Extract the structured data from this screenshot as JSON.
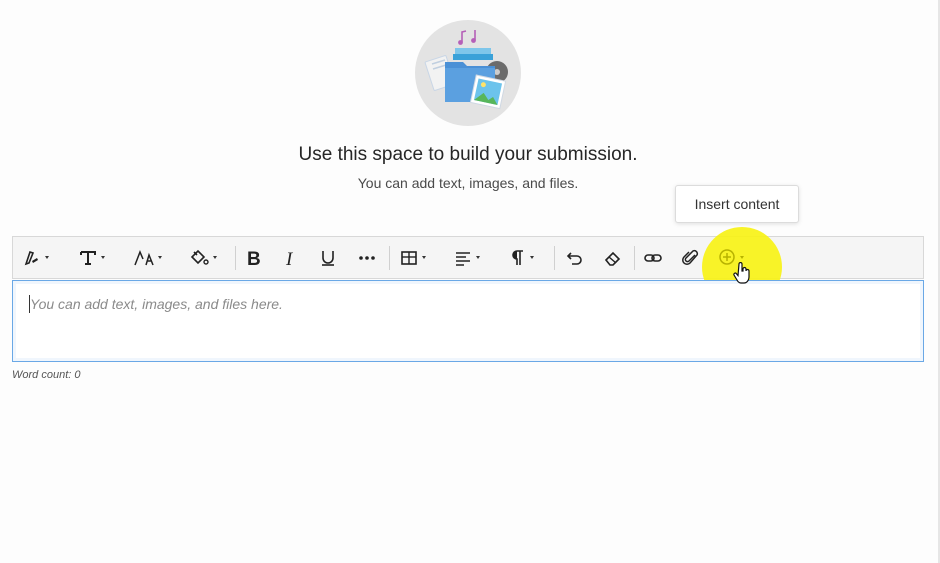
{
  "empty_state": {
    "illustration": "folder-with-media-icon",
    "headline": "Use this space to build your submission.",
    "subline": "You can add text, images, and files."
  },
  "tooltip": {
    "text": "Insert content"
  },
  "toolbar": {
    "buttons": [
      {
        "name": "text-style-button",
        "icon": "pen-icon",
        "dropdown": true
      },
      {
        "name": "font-type-button",
        "icon": "font-type-icon",
        "dropdown": true
      },
      {
        "name": "font-size-button",
        "icon": "font-size-icon",
        "dropdown": true
      },
      {
        "name": "text-color-button",
        "icon": "paint-bucket-icon",
        "dropdown": true
      },
      {
        "name": "bold-button",
        "icon": "bold-icon"
      },
      {
        "name": "italic-button",
        "icon": "italic-icon"
      },
      {
        "name": "underline-button",
        "icon": "underline-icon"
      },
      {
        "name": "more-formatting-button",
        "icon": "more-icon"
      },
      {
        "name": "table-button",
        "icon": "table-icon",
        "dropdown": true
      },
      {
        "name": "align-button",
        "icon": "align-left-icon",
        "dropdown": true
      },
      {
        "name": "paragraph-button",
        "icon": "pilcrow-icon",
        "dropdown": true
      },
      {
        "name": "undo-button",
        "icon": "undo-icon"
      },
      {
        "name": "clear-formatting-button",
        "icon": "eraser-icon"
      },
      {
        "name": "insert-link-button",
        "icon": "link-icon"
      },
      {
        "name": "attach-file-button",
        "icon": "paperclip-icon"
      },
      {
        "name": "insert-content-button",
        "icon": "plus-circle-icon",
        "dropdown": true
      }
    ]
  },
  "editor": {
    "placeholder": "You can add text, images, and files here.",
    "value": ""
  },
  "footer": {
    "word_count": "Word count: 0"
  },
  "colors": {
    "highlight": "#f7f216",
    "editor_border": "#6aa8e6",
    "toolbar_bg": "#f5f5f5"
  }
}
